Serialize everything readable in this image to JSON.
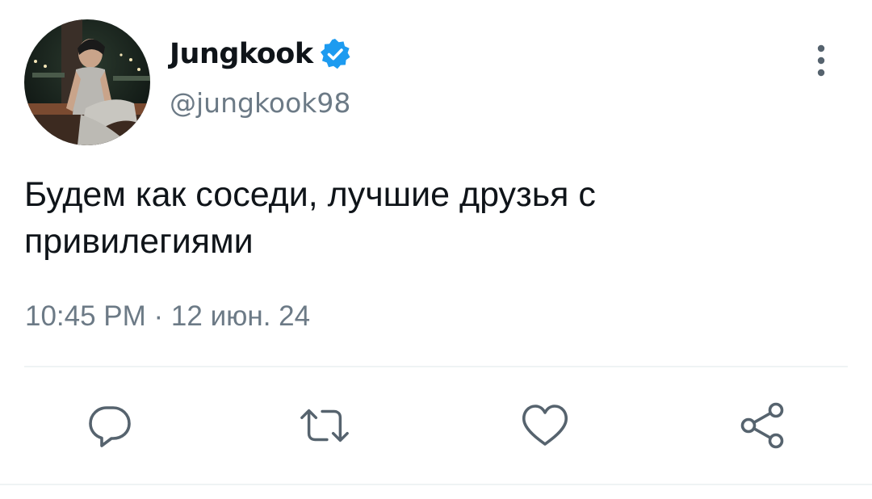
{
  "author": {
    "display_name": "Jungkook",
    "handle": "@jungkook98",
    "verified": true,
    "verified_color": "#1d9bf0",
    "avatar_icon": "profile-photo"
  },
  "tweet": {
    "text": "Будем как соседи, лучшие друзья с\nпривилегиями",
    "timestamp": "10:45 PM · 12 июн. 24"
  },
  "actions": [
    {
      "icon": "reply-icon"
    },
    {
      "icon": "retweet-icon"
    },
    {
      "icon": "like-icon"
    },
    {
      "icon": "share-icon"
    }
  ],
  "colors": {
    "text_primary": "#0f1419",
    "text_secondary": "#6c7a86",
    "icon_color": "#56636e"
  }
}
